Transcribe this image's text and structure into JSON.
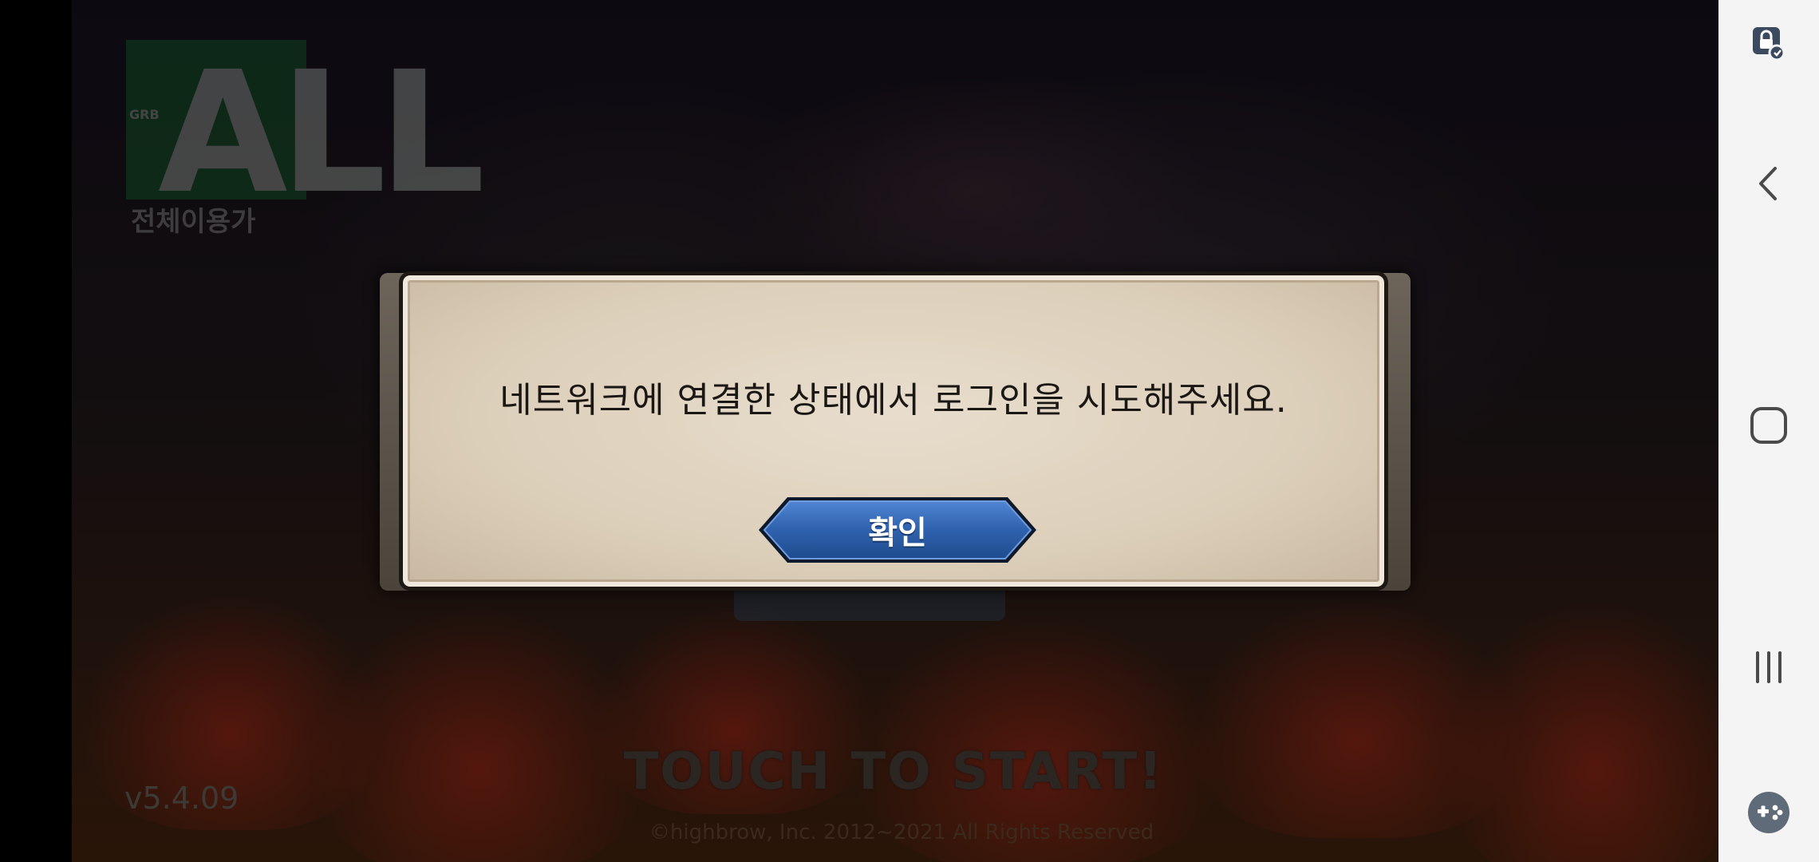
{
  "game": {
    "age_rating": {
      "badge_letter": "ALL",
      "badge_small": "GRB",
      "label": "전체이용가"
    },
    "version": "v5.4.09",
    "touch_to_start": "TOUCH TO START!",
    "copyright": "©highbrow, Inc. 2012~2021 All Rights Reserved"
  },
  "dialog": {
    "message": "네트워크에 연결한 상태에서 로그인을 시도해주세요.",
    "confirm_label": "확인",
    "button_color": "#2f62ad"
  },
  "navbar": {
    "items": [
      {
        "icon": "touch-lock-icon"
      },
      {
        "icon": "back-icon"
      },
      {
        "icon": "home-icon"
      },
      {
        "icon": "recents-icon"
      },
      {
        "icon": "game-tools-icon"
      }
    ]
  }
}
